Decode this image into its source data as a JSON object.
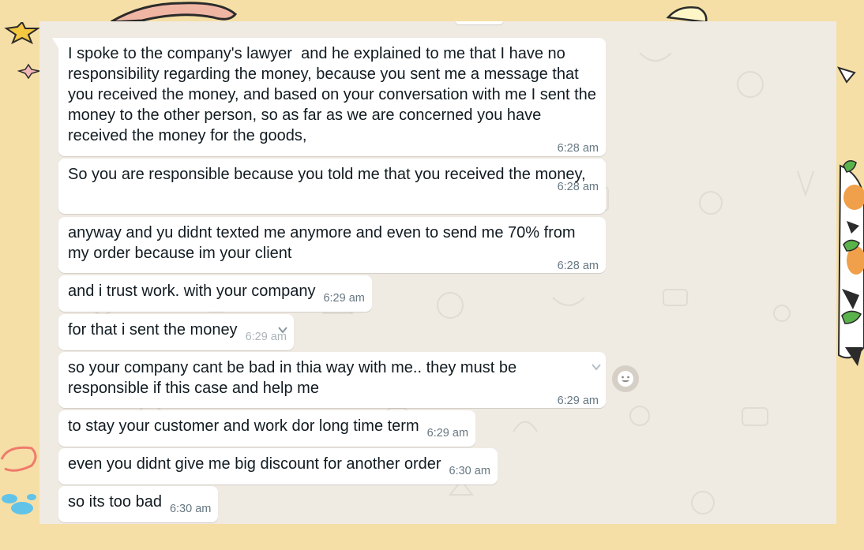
{
  "colors": {
    "wallpaper": "#f6dfa6",
    "chat_background": "#efeae2",
    "bubble": "#ffffff",
    "text": "#111b21",
    "timestamp": "#667781"
  },
  "messages": [
    {
      "text": "I spoke to the company's lawyer  and he explained to me that I have no responsibility regarding the money, because you sent me a message that you received the money, and based on your conversation with me I sent the money to the other person, so as far as we are concerned you have received the money for the goods,",
      "time": "6:28 am"
    },
    {
      "text": "So you are responsible because you told me that you received the money,",
      "time": "6:28 am"
    },
    {
      "text": "anyway and yu didnt texted me anymore and even to send me 70% from my order because im your client",
      "time": "6:28 am"
    },
    {
      "text": "and i trust work. with your company",
      "time": "6:29 am"
    },
    {
      "text": "for that i sent the money",
      "time": "6:29 am"
    },
    {
      "text": "so your company cant be bad in thia way with me.. they must be responsible if this case and help me",
      "time": "6:29 am"
    },
    {
      "text": "to stay your customer and work dor long time term",
      "time": "6:29 am"
    },
    {
      "text": "even you didnt give me big discount for another order",
      "time": "6:30 am"
    },
    {
      "text": "so its too bad",
      "time": "6:30 am"
    }
  ],
  "icons": {
    "message_menu": "chevron-down-icon",
    "reaction": "smiley-icon"
  }
}
